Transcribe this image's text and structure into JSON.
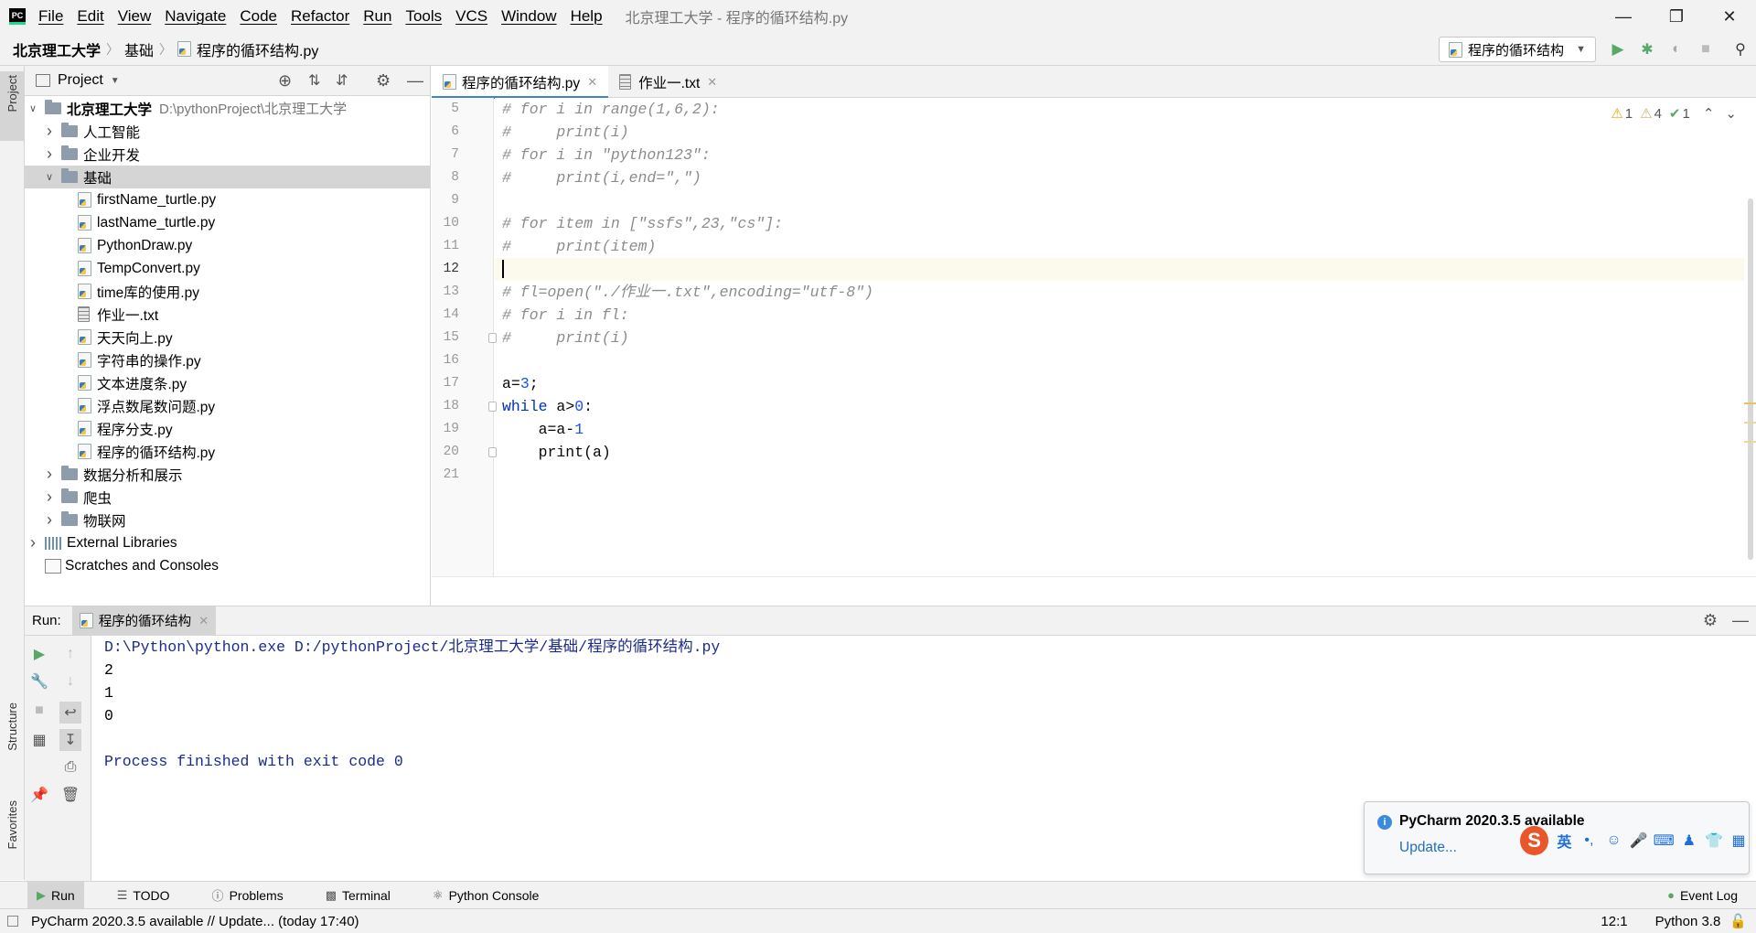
{
  "window": {
    "title": "北京理工大学 - 程序的循环结构.py",
    "menu": [
      "File",
      "Edit",
      "View",
      "Navigate",
      "Code",
      "Refactor",
      "Run",
      "Tools",
      "VCS",
      "Window",
      "Help"
    ]
  },
  "navbar": {
    "breadcrumbs": [
      "北京理工大学",
      "基础",
      "程序的循环结构.py"
    ],
    "run_config": "程序的循环结构"
  },
  "left_strip": {
    "project": "Project",
    "structure": "Structure",
    "favorites": "Favorites"
  },
  "project": {
    "header": "Project",
    "root": {
      "name": "北京理工大学",
      "path": "D:\\pythonProject\\北京理工大学"
    },
    "folders_before": [
      "人工智能",
      "企业开发"
    ],
    "open_folder": "基础",
    "files": [
      "firstName_turtle.py",
      "lastName_turtle.py",
      "PythonDraw.py",
      "TempConvert.py",
      "time库的使用.py",
      "作业一.txt",
      "天天向上.py",
      "字符串的操作.py",
      "文本进度条.py",
      "浮点数尾数问题.py",
      "程序分支.py",
      "程序的循环结构.py"
    ],
    "folders_after": [
      "数据分析和展示",
      "爬虫",
      "物联网"
    ],
    "external_libraries": "External Libraries",
    "scratches": "Scratches and Consoles"
  },
  "editor": {
    "tabs": [
      {
        "label": "程序的循环结构.py",
        "active": true
      },
      {
        "label": "作业一.txt",
        "active": false
      }
    ],
    "line_numbers": [
      "5",
      "6",
      "7",
      "8",
      "9",
      "10",
      "11",
      "12",
      "13",
      "14",
      "15",
      "16",
      "17",
      "18",
      "19",
      "20",
      "21"
    ],
    "lines": [
      "# for i in range(1,6,2):",
      "#     print(i)",
      "# for i in \"python123\":",
      "#     print(i,end=\",\")",
      "",
      "# for item in [\"ssfs\",23,\"cs\"]:",
      "#     print(item)",
      "",
      "# fl=open(\"./作业一.txt\",encoding=\"utf-8\")",
      "# for i in fl:",
      "#     print(i)",
      "",
      "a=3;",
      "while a>0:",
      "    a=a-1",
      "    print(a)",
      ""
    ],
    "inspections": {
      "warnings": "1",
      "weak_warnings": "4",
      "ok": "1"
    }
  },
  "run": {
    "label": "Run:",
    "tab": "程序的循环结构",
    "output": [
      "D:\\Python\\python.exe D:/pythonProject/北京理工大学/基础/程序的循环结构.py",
      "2",
      "1",
      "0",
      "",
      "Process finished with exit code 0"
    ]
  },
  "tool_tabs": [
    "Run",
    "TODO",
    "Problems",
    "Terminal",
    "Python Console"
  ],
  "event_log": "Event Log",
  "notification": {
    "title": "PyCharm 2020.3.5 available",
    "link": "Update..."
  },
  "ime": {
    "lang": "英",
    "punct": "•,"
  },
  "status": {
    "message": "PyCharm 2020.3.5 available // Update... (today 17:40)",
    "position": "12:1",
    "interpreter": "Python 3.8"
  },
  "colors": {
    "accent": "#4083c9",
    "keyword": "#0033b3",
    "number": "#1750eb",
    "comment": "#8c8c8c",
    "console_path": "#1b2b8c",
    "run_green": "#59a869"
  }
}
